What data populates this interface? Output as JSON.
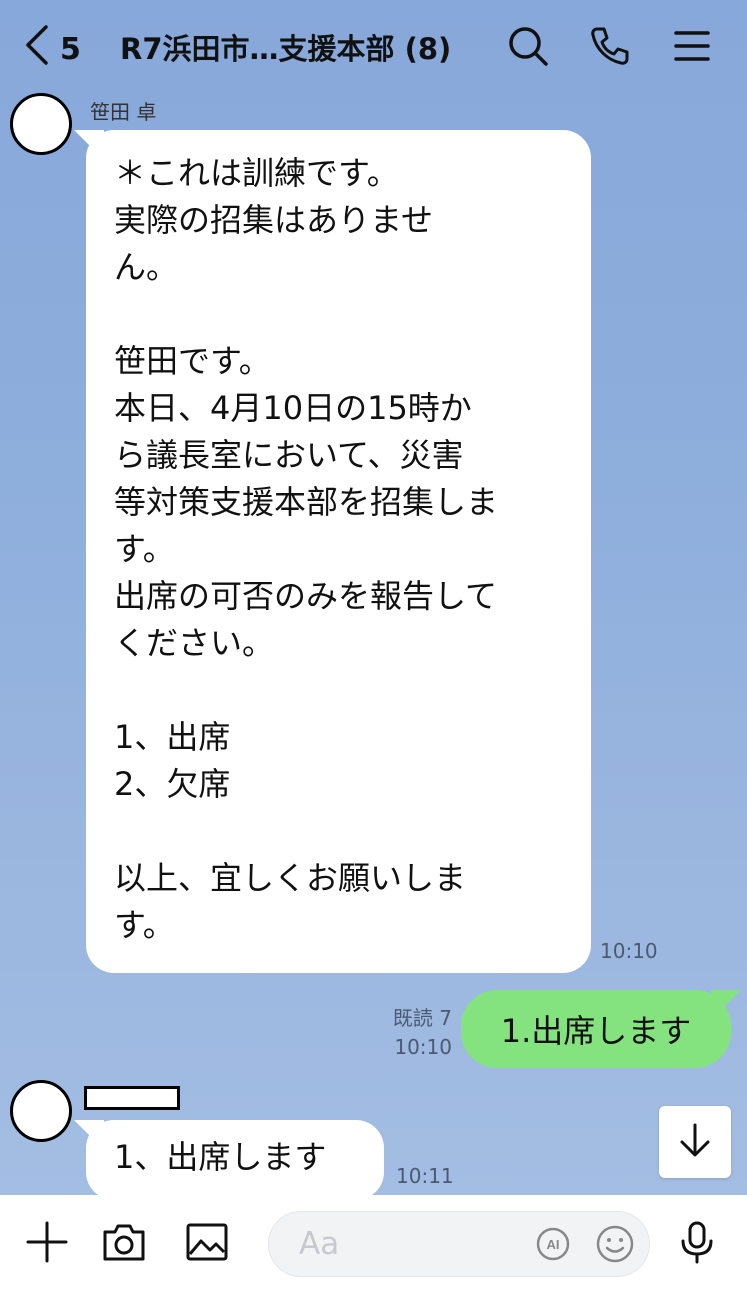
{
  "header": {
    "back_count": "5",
    "title": "R7浜田市…支援本部 (8)",
    "icons": [
      "chevron-left-icon",
      "search-icon",
      "phone-icon",
      "menu-icon"
    ]
  },
  "messages": [
    {
      "sender": "笹田 卓",
      "lines": [
        "＊これは訓練です。",
        "実際の招集はありませ",
        "ん。",
        "",
        "笹田です。",
        "本日、4月10日の15時か",
        "ら議長室において、災害",
        "等対策支援本部を招集しま",
        "す。",
        "出席の可否のみを報告して",
        "ください。",
        "",
        "1、出席",
        "2、欠席",
        "",
        "以上、宜しくお願いしま",
        "す。"
      ],
      "time": "10:10"
    },
    {
      "outgoing": true,
      "text": "1.出席します",
      "read": "既読 7",
      "time": "10:10"
    },
    {
      "sender": "",
      "text": "1、出席します",
      "time": "10:11"
    }
  ],
  "composer": {
    "placeholder": "Aa",
    "ai_label": "AI"
  },
  "colors": {
    "chat_background": "#8aaad6",
    "outgoing_bubble": "#85e37f",
    "incoming_bubble": "#ffffff"
  }
}
